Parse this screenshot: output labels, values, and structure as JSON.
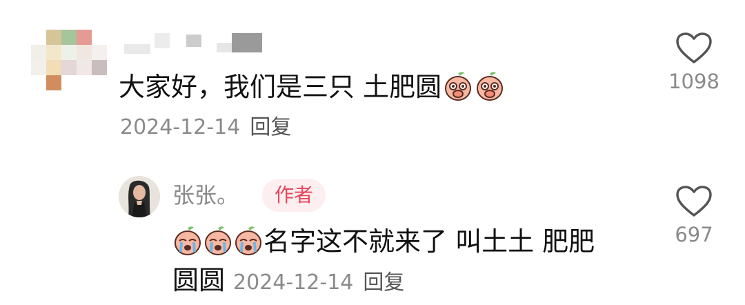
{
  "comment": {
    "text": "大家好，我们是三只 土肥圆",
    "emoji_count": 2,
    "date": "2024-12-14",
    "reply_label": "回复",
    "likes": "1098",
    "emoji_name": "peach-cover-face-emoji"
  },
  "reply": {
    "username": "张张。",
    "badge": "作者",
    "text_line1": "名字这不就来了 叫土土 肥肥",
    "text_line2": "圆圆",
    "emoji_count": 3,
    "date": "2024-12-14",
    "reply_label": "回复",
    "likes": "697",
    "emoji_name": "peach-crying-emoji"
  },
  "colors": {
    "text": "#111111",
    "meta": "#8a8a8a",
    "badge_bg": "#fdeef0",
    "badge_fg": "#e8455a"
  }
}
